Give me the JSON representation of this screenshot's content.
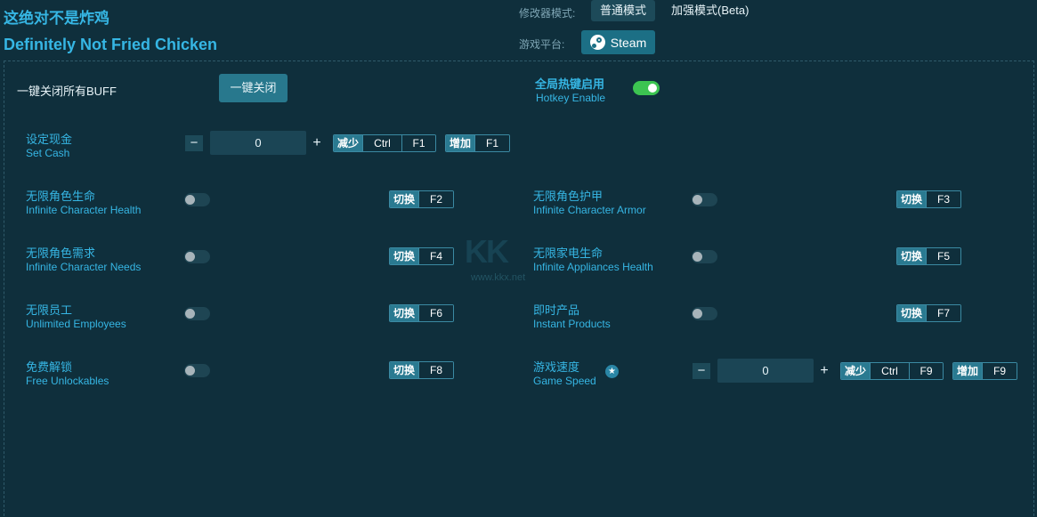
{
  "title_cn": "这绝对不是炸鸡",
  "title_en": "Definitely Not Fried Chicken",
  "header": {
    "mode_label": "修改器模式:",
    "mode_normal": "普通模式",
    "mode_enhanced": "加强模式(Beta)",
    "platform_label": "游戏平台:",
    "platform": "Steam"
  },
  "close_all": {
    "label": "一键关闭所有BUFF",
    "button": "一键关闭"
  },
  "hotkey": {
    "cn": "全局热键启用",
    "en": "Hotkey Enable",
    "enabled": true
  },
  "set_cash": {
    "cn": "设定现金",
    "en": "Set Cash",
    "value": "0",
    "minus": "−",
    "plus": "+",
    "dec_label": "减少",
    "dec_mod": "Ctrl",
    "dec_key": "F1",
    "inc_label": "增加",
    "inc_key": "F1"
  },
  "toggle_label": "切换",
  "cheats": [
    {
      "cn": "无限角色生命",
      "en": "Infinite Character Health",
      "key": "F2"
    },
    {
      "cn": "无限角色护甲",
      "en": "Infinite Character Armor",
      "key": "F3"
    },
    {
      "cn": "无限角色需求",
      "en": "Infinite Character Needs",
      "key": "F4"
    },
    {
      "cn": "无限家电生命",
      "en": "Infinite Appliances Health",
      "key": "F5"
    },
    {
      "cn": "无限员工",
      "en": "Unlimited Employees",
      "key": "F6"
    },
    {
      "cn": "即时产品",
      "en": "Instant Products",
      "key": "F7"
    },
    {
      "cn": "免费解锁",
      "en": "Free Unlockables",
      "key": "F8"
    }
  ],
  "game_speed": {
    "cn": "游戏速度",
    "en": "Game Speed",
    "value": "0",
    "minus": "−",
    "plus": "+",
    "star": "★",
    "dec_label": "减少",
    "dec_mod": "Ctrl",
    "dec_key": "F9",
    "inc_label": "增加",
    "inc_key": "F9"
  },
  "watermark": {
    "logo": "KK",
    "url": "www.kkx.net"
  }
}
